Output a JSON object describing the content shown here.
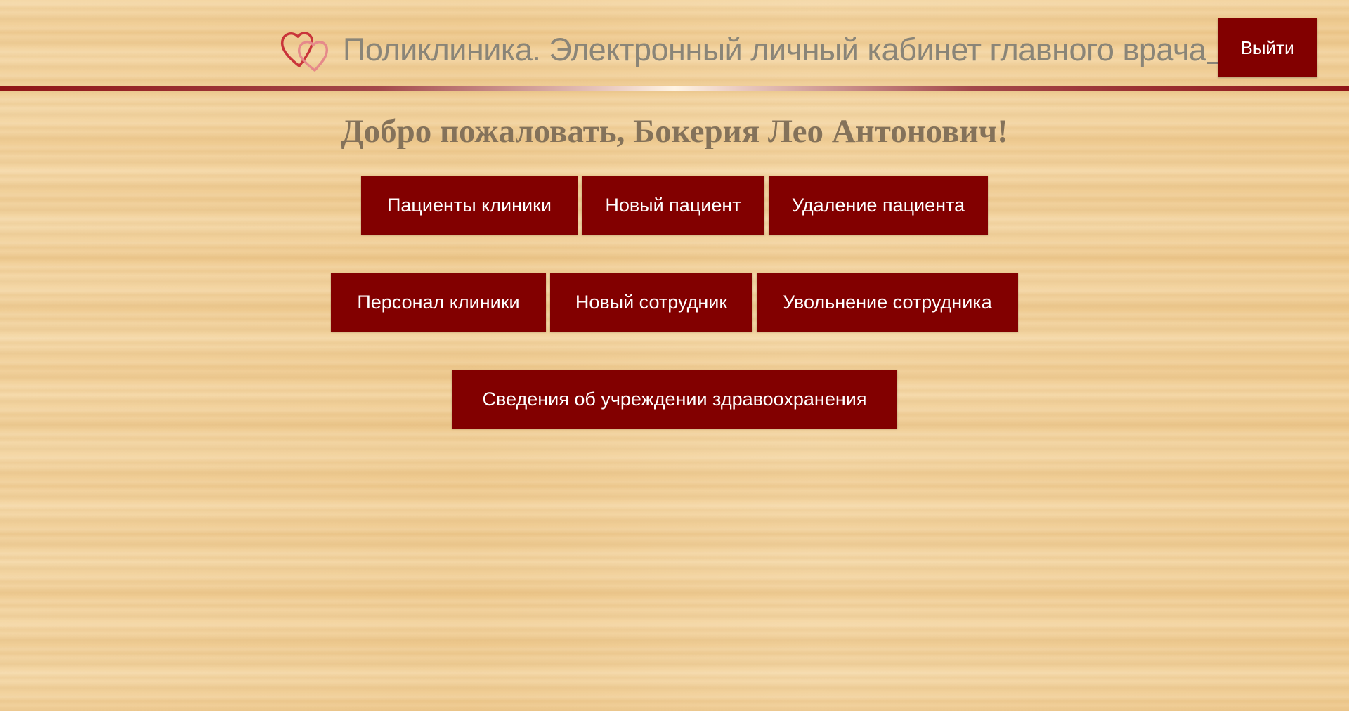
{
  "header": {
    "title": "Поликлиника. Электронный личный кабинет главного врача",
    "logout_label": "Выйти",
    "logo_icon": "hearts-icon"
  },
  "welcome": {
    "text": "Добро пожаловать, Бокерия Лео Антонович!"
  },
  "menu": {
    "rows": [
      [
        {
          "label": "Пациенты клиники"
        },
        {
          "label": "Новый пациент"
        },
        {
          "label": "Удаление пациента"
        }
      ],
      [
        {
          "label": "Персонал клиники"
        },
        {
          "label": "Новый сотрудник"
        },
        {
          "label": "Увольнение сотрудника"
        }
      ],
      [
        {
          "label": "Сведения об учреждении здравоохранения"
        }
      ]
    ]
  },
  "colors": {
    "accent": "#820000",
    "title_text": "#8a8578",
    "welcome_text": "#84725a",
    "background": "#f1cf96"
  }
}
